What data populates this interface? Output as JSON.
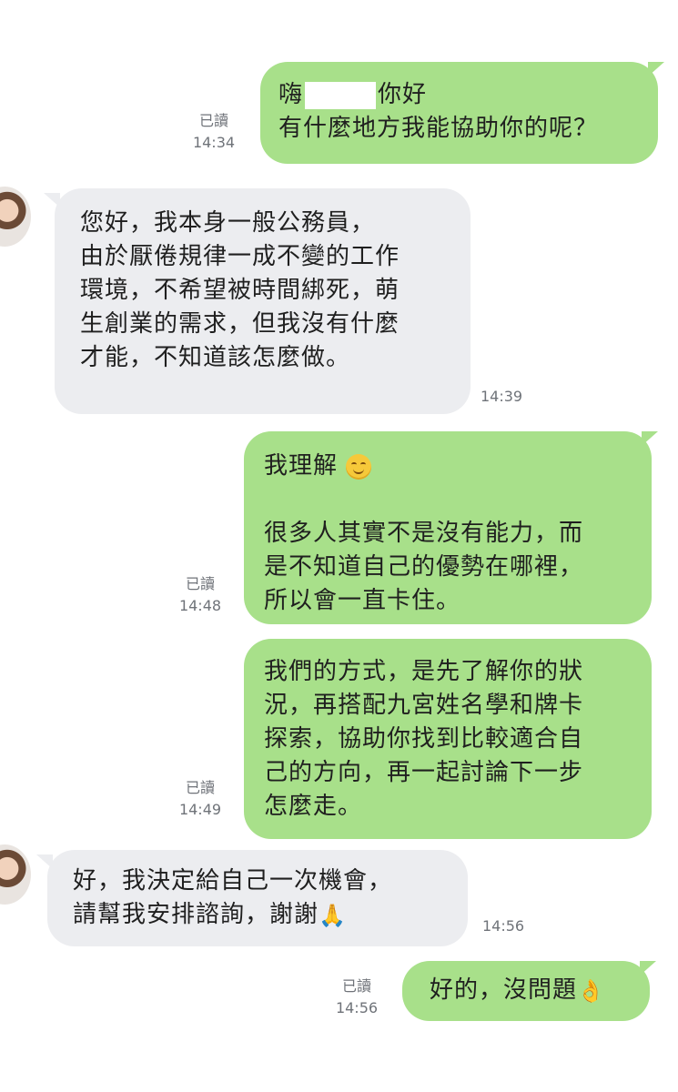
{
  "messages": [
    {
      "id": "m1",
      "sender": "me",
      "read_label": "已讀",
      "time": "14:34",
      "lines": [
        "嗨",
        "你好",
        "有什麼地方我能協助你的呢？"
      ]
    },
    {
      "id": "m2",
      "sender": "other",
      "time": "14:39",
      "lines": [
        "您好，我本身一般公務員，",
        "由於厭倦規律一成不變的工作",
        "環境，不希望被時間綁死，萌",
        "生創業的需求，但我沒有什麼",
        "才能，不知道該怎麼做。"
      ]
    },
    {
      "id": "m3",
      "sender": "me",
      "read_label": "已讀",
      "time": "14:48",
      "lines": [
        "我理解",
        "很多人其實不是沒有能力，而",
        "是不知道自己的優勢在哪裡，",
        "所以會一直卡住。"
      ],
      "emoji": "smiling-face"
    },
    {
      "id": "m4",
      "sender": "me",
      "read_label": "已讀",
      "time": "14:49",
      "lines": [
        "我們的方式，是先了解你的狀",
        "況，再搭配九宮姓名學和牌卡",
        "探索，協助你找到比較適合自",
        "己的方向，再一起討論下一步",
        "怎麼走。"
      ]
    },
    {
      "id": "m5",
      "sender": "other",
      "time": "14:56",
      "lines": [
        "好，我決定給自己一次機會，",
        "請幫我安排諮詢，謝謝"
      ],
      "emoji": "folded-hands"
    },
    {
      "id": "m6",
      "sender": "me",
      "read_label": "已讀",
      "time": "14:56",
      "lines": [
        "好的，沒問題"
      ],
      "emoji": "ok-hand"
    }
  ],
  "colors": {
    "outgoing_bubble": "#a8e08a",
    "incoming_bubble": "#ecedf0",
    "meta_text": "#6f7379"
  },
  "emoji_glyphs": {
    "folded-hands": "🙏",
    "ok-hand": "👌"
  }
}
